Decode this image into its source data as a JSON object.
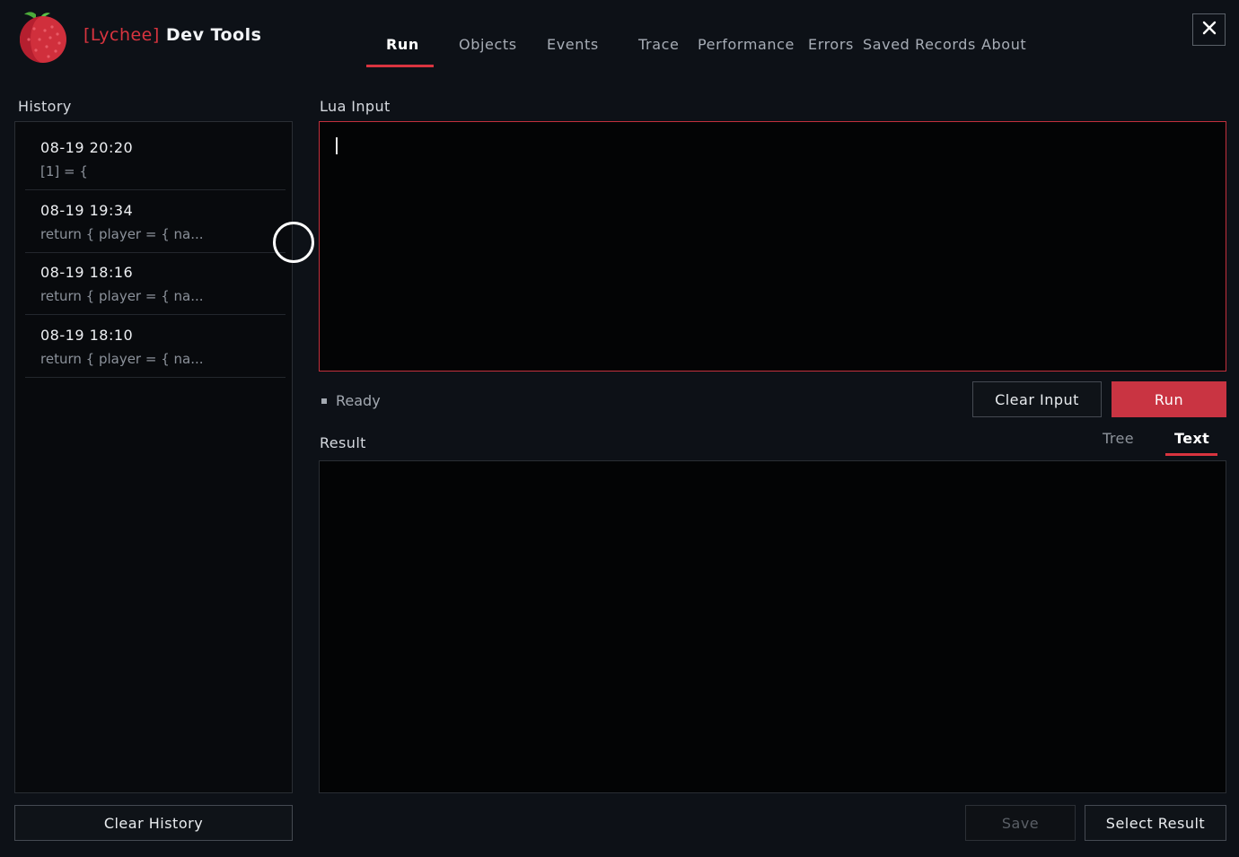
{
  "app": {
    "brand": "[Lychee]",
    "title": "Dev Tools",
    "icons": {
      "logo": "lychee-logo",
      "close": "close-icon"
    },
    "accent_color": "#d9343f"
  },
  "tabs": [
    {
      "label": "Run",
      "active": true
    },
    {
      "label": "Objects",
      "active": false
    },
    {
      "label": "Events",
      "active": false
    },
    {
      "label": "Trace",
      "active": false
    },
    {
      "label": "Performance",
      "active": false
    },
    {
      "label": "Errors",
      "active": false
    },
    {
      "label": "Saved Records",
      "active": false
    },
    {
      "label": "About",
      "active": false
    }
  ],
  "history": {
    "label": "History",
    "items": [
      {
        "time": "08-19 20:20",
        "snippet": "[1] = {"
      },
      {
        "time": "08-19 19:34",
        "snippet": "return { player = { na..."
      },
      {
        "time": "08-19 18:16",
        "snippet": "return { player = { na..."
      },
      {
        "time": "08-19 18:10",
        "snippet": "return { player = { na..."
      }
    ],
    "clear_label": "Clear History"
  },
  "lua_input": {
    "label": "Lua Input",
    "value": ""
  },
  "controls": {
    "status": "Ready",
    "clear_input_label": "Clear Input",
    "run_label": "Run"
  },
  "result": {
    "label": "Result",
    "views": [
      {
        "label": "Tree",
        "active": false
      },
      {
        "label": "Text",
        "active": true
      }
    ],
    "value": "",
    "save_label": "Save",
    "select_label": "Select Result"
  }
}
